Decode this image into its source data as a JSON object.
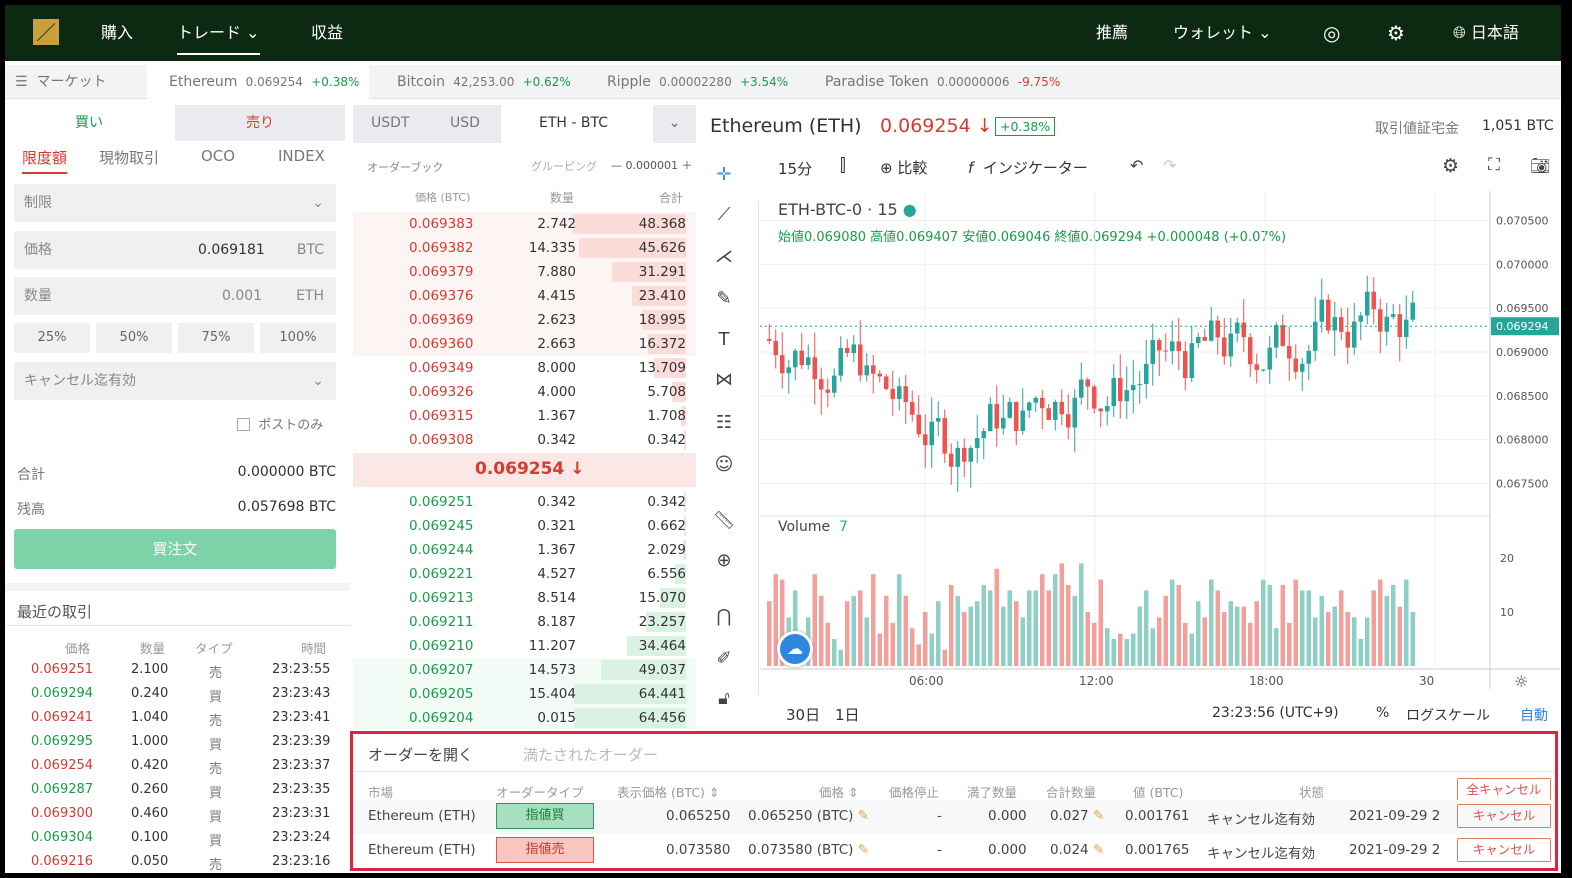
{
  "nav": {
    "buy": "購入",
    "trade": "トレード",
    "earn": "収益",
    "recommend": "推薦",
    "wallet": "ウォレット",
    "language": "日本語"
  },
  "tickers": {
    "market_label": "マーケット",
    "items": [
      {
        "name": "Ethereum",
        "price": "0.069254",
        "change": "+0.38%",
        "color": "#1a9a4a"
      },
      {
        "name": "Bitcoin",
        "price": "42,253.00",
        "change": "+0.62%",
        "color": "#1a9a4a"
      },
      {
        "name": "Ripple",
        "price": "0.00002280",
        "change": "+3.54%",
        "color": "#1a9a4a"
      },
      {
        "name": "Paradise Token",
        "price": "0.00000006",
        "change": "-9.75%",
        "color": "#d63b2f"
      }
    ]
  },
  "order_form": {
    "buy_tab": "買い",
    "sell_tab": "売り",
    "types": [
      "限度額",
      "現物取引",
      "OCO",
      "INDEX"
    ],
    "order_type": "制限",
    "price_label": "価格",
    "price_value": "0.069181",
    "price_unit": "BTC",
    "qty_label": "数量",
    "qty_value": "0.001",
    "qty_unit": "ETH",
    "percents": [
      "25%",
      "50%",
      "75%",
      "100%"
    ],
    "tif": "キャンセル迄有効",
    "post_only": "ポストのみ",
    "total_label": "合計",
    "total_value": "0.000000 BTC",
    "balance_label": "残高",
    "balance_value": "0.057698 BTC",
    "submit": "買注文"
  },
  "recent_trades": {
    "title": "最近の取引",
    "headers": [
      "価格",
      "数量",
      "タイプ",
      "時間"
    ],
    "rows": [
      {
        "price": "0.069251",
        "qty": "2.100",
        "type": "売",
        "time": "23:23:55",
        "side": "sell"
      },
      {
        "price": "0.069294",
        "qty": "0.240",
        "type": "買",
        "time": "23:23:43",
        "side": "buy"
      },
      {
        "price": "0.069241",
        "qty": "1.040",
        "type": "売",
        "time": "23:23:41",
        "side": "sell"
      },
      {
        "price": "0.069295",
        "qty": "1.000",
        "type": "買",
        "time": "23:23:39",
        "side": "buy"
      },
      {
        "price": "0.069254",
        "qty": "0.420",
        "type": "売",
        "time": "23:23:37",
        "side": "sell"
      },
      {
        "price": "0.069287",
        "qty": "0.260",
        "type": "買",
        "time": "23:23:35",
        "side": "buy"
      },
      {
        "price": "0.069300",
        "qty": "0.460",
        "type": "買",
        "time": "23:23:31",
        "side": "sell"
      },
      {
        "price": "0.069304",
        "qty": "0.100",
        "type": "買",
        "time": "23:23:24",
        "side": "buy"
      },
      {
        "price": "0.069216",
        "qty": "0.050",
        "type": "売",
        "time": "23:23:16",
        "side": "sell"
      }
    ]
  },
  "orderbook": {
    "tabs": [
      "USDT",
      "USD",
      "ETH - BTC"
    ],
    "title": "オーダーブック",
    "grouping": "グルーピング",
    "grouping_value": "0.000001",
    "headers": [
      "価格 (BTC)",
      "数量",
      "合計"
    ],
    "asks": [
      {
        "price": "0.069383",
        "qty": "2.742",
        "total": "48.368",
        "depth": 0.75
      },
      {
        "price": "0.069382",
        "qty": "14.335",
        "total": "45.626",
        "depth": 0.71
      },
      {
        "price": "0.069379",
        "qty": "7.880",
        "total": "31.291",
        "depth": 0.49
      },
      {
        "price": "0.069376",
        "qty": "4.415",
        "total": "23.410",
        "depth": 0.36
      },
      {
        "price": "0.069369",
        "qty": "2.623",
        "total": "18.995",
        "depth": 0.29
      },
      {
        "price": "0.069360",
        "qty": "2.663",
        "total": "16.372",
        "depth": 0.25
      },
      {
        "price": "0.069349",
        "qty": "8.000",
        "total": "13.709",
        "depth": 0.21
      },
      {
        "price": "0.069326",
        "qty": "4.000",
        "total": "5.708",
        "depth": 0.09
      },
      {
        "price": "0.069315",
        "qty": "1.367",
        "total": "1.708",
        "depth": 0.03
      },
      {
        "price": "0.069308",
        "qty": "0.342",
        "total": "0.342",
        "depth": 0.01
      }
    ],
    "mid_price": "0.069254",
    "bids": [
      {
        "price": "0.069251",
        "qty": "0.342",
        "total": "0.342",
        "depth": 0.01
      },
      {
        "price": "0.069245",
        "qty": "0.321",
        "total": "0.662",
        "depth": 0.01
      },
      {
        "price": "0.069244",
        "qty": "1.367",
        "total": "2.029",
        "depth": 0.03
      },
      {
        "price": "0.069221",
        "qty": "4.527",
        "total": "6.556",
        "depth": 0.1
      },
      {
        "price": "0.069213",
        "qty": "8.514",
        "total": "15.070",
        "depth": 0.23
      },
      {
        "price": "0.069211",
        "qty": "8.187",
        "total": "23.257",
        "depth": 0.36
      },
      {
        "price": "0.069210",
        "qty": "11.207",
        "total": "34.464",
        "depth": 0.53
      },
      {
        "price": "0.069207",
        "qty": "14.573",
        "total": "49.037",
        "depth": 0.76
      },
      {
        "price": "0.069205",
        "qty": "15.404",
        "total": "64.441",
        "depth": 1.0
      },
      {
        "price": "0.069204",
        "qty": "0.015",
        "total": "64.456",
        "depth": 1.0
      }
    ]
  },
  "chart": {
    "pair_title": "Ethereum (ETH)",
    "price": "0.069254",
    "change": "+0.38%",
    "margin_label": "取引値証宅金",
    "margin_value": "1,051 BTC",
    "interval": "15分",
    "compare": "比較",
    "indicators": "インジケーター",
    "symbol": "ETH-BTC-0 · 15",
    "ohlc": "始値0.069080 高値0.069407 安値0.069046 終値0.069294 +0.000048 (+0.07%)",
    "volume_label": "Volume",
    "volume_value": "7",
    "price_ticks": [
      "0.070500",
      "0.070000",
      "0.069500",
      "0.069294",
      "0.069000",
      "0.068500",
      "0.068000",
      "0.067500"
    ],
    "vol_ticks": [
      "20",
      "10"
    ],
    "time_ticks": [
      "06:00",
      "12:00",
      "18:00",
      "30"
    ],
    "ranges": [
      "30日",
      "1日"
    ],
    "clock": "23:23:56 (UTC+9)",
    "pct": "%",
    "log": "ログスケール",
    "auto": "自動"
  },
  "chart_data": {
    "type": "bar",
    "title": "ETH-BTC-0 · 15",
    "ylim": [
      0.0673,
      0.0707
    ],
    "series": [
      {
        "name": "Volume",
        "values": [
          12,
          17,
          16,
          9,
          14,
          6,
          9,
          17,
          13,
          8,
          5,
          3,
          12,
          13,
          14,
          9,
          17,
          6,
          13,
          8,
          17,
          13,
          7,
          4,
          10,
          6,
          12,
          3,
          15,
          13,
          10,
          11,
          12,
          15,
          14,
          18,
          11,
          14,
          12,
          9,
          14,
          14,
          17,
          14,
          17,
          19,
          15,
          13,
          19,
          10,
          8,
          16,
          7,
          5,
          6,
          5,
          6,
          11,
          14,
          7,
          9,
          13,
          16,
          15,
          8,
          6,
          12,
          9,
          16,
          14,
          10,
          12,
          11,
          11,
          8,
          12,
          16,
          15,
          7,
          15,
          8,
          16,
          14,
          14,
          9,
          13,
          10,
          11,
          14,
          10,
          9,
          5,
          9,
          14,
          16,
          13,
          15,
          11,
          16,
          10
        ]
      }
    ],
    "x_labels": [
      "06:00",
      "12:00",
      "18:00",
      "30"
    ]
  },
  "orders": {
    "tab_open": "オーダーを開く",
    "tab_filled": "満たされたオーダー",
    "headers": [
      "市場",
      "オーダータイプ",
      "表示価格 (BTC)",
      "価格",
      "価格停止",
      "満了数量",
      "合計数量",
      "値 (BTC)",
      "状態"
    ],
    "cancel_all": "全キャンセル",
    "rows": [
      {
        "market": "Ethereum (ETH)",
        "type": "指値買",
        "side": "buy",
        "display": "0.065250",
        "price": "0.065250 (BTC)",
        "stop": "-",
        "filled": "0.000",
        "total": "0.027",
        "value": "0.001761",
        "status": "キャンセル迄有効",
        "date": "2021-09-29 2",
        "cancel": "キャンセル"
      },
      {
        "market": "Ethereum (ETH)",
        "type": "指値売",
        "side": "sell",
        "display": "0.073580",
        "price": "0.073580 (BTC)",
        "stop": "-",
        "filled": "0.000",
        "total": "0.024",
        "value": "0.001765",
        "status": "キャンセル迄有効",
        "date": "2021-09-29 2",
        "cancel": "キャンセル"
      }
    ]
  }
}
